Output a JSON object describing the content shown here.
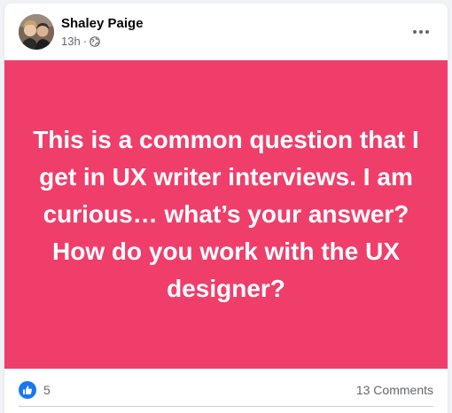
{
  "post": {
    "author": "Shaley Paige",
    "time": "13h",
    "separator": "·",
    "audience_icon": "globe-icon",
    "more_icon": "more-options-icon",
    "banner_background": "#f03e6b",
    "text": "This is a common question that I get in UX writer interviews. I am curious… what’s your answer? How do you work with the UX designer?"
  },
  "reactions": {
    "icon": "like-icon",
    "count": "5",
    "accent": "#1877f2"
  },
  "comments": {
    "label": "13 Comments"
  }
}
